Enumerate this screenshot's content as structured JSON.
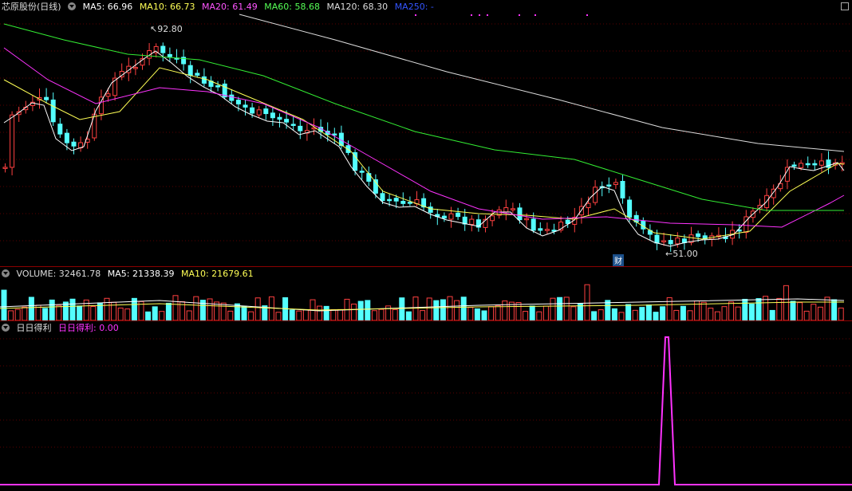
{
  "main": {
    "stock_name": "芯原股份(日线)",
    "indicators": [
      {
        "label": "MA5: 66.96",
        "color": "#ffffff"
      },
      {
        "label": "MA10: 66.73",
        "color": "#ffff55"
      },
      {
        "label": "MA20: 61.49",
        "color": "#ff55ff"
      },
      {
        "label": "MA60: 58.68",
        "color": "#55ff55"
      },
      {
        "label": "MA120: 68.30",
        "color": "#dddddd"
      },
      {
        "label": "MA250: -",
        "color": "#3355ff"
      }
    ],
    "high_marker": "92.80",
    "low_marker": "51.00",
    "event_badge": "财",
    "colors": {
      "up": "#ff4040",
      "down": "#54ffff",
      "ma5": "#ffffff",
      "ma10": "#ffff55",
      "ma20": "#ff33ff",
      "ma60": "#33ee33",
      "ma120": "#dddddd"
    }
  },
  "volume": {
    "label": "VOLUME: 32461.78",
    "ma5": "MA5: 21338.39",
    "ma10": "MA10: 21679.61"
  },
  "indicator": {
    "name": "日日得利",
    "value_label": "日日得利: 0.00",
    "color": "#ff33ff"
  }
}
